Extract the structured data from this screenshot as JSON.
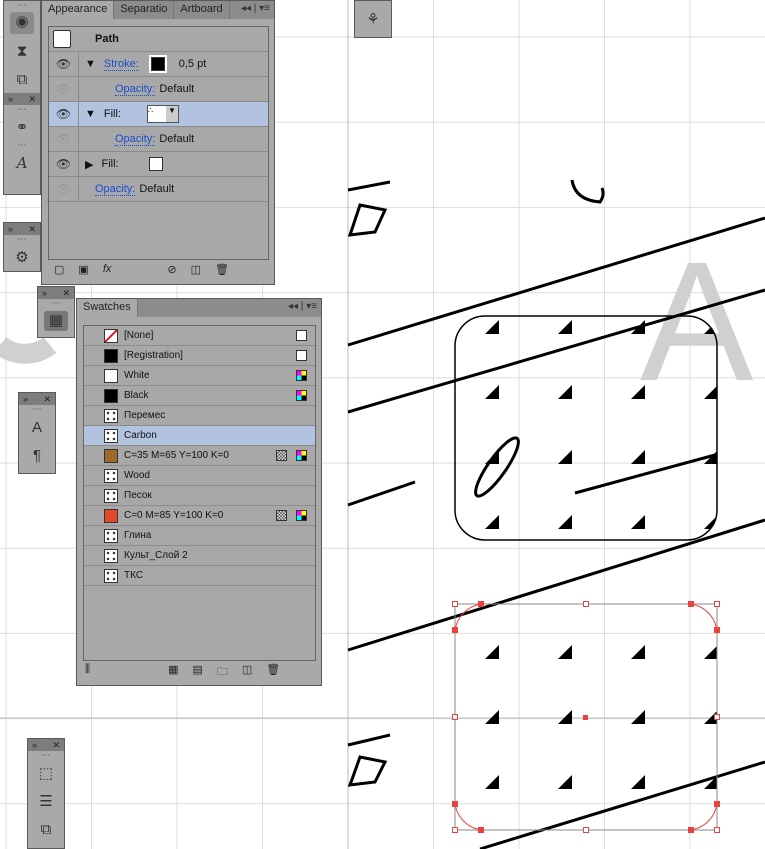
{
  "appearance": {
    "tabs": [
      "Appearance",
      "Separatio",
      "Artboard"
    ],
    "title": "Path",
    "rows": [
      {
        "label": "Stroke:",
        "value": "0,5 pt",
        "expanded": true,
        "link": true
      },
      {
        "label": "Opacity:",
        "value": "Default",
        "indent": true
      },
      {
        "label": "Fill:",
        "value": "",
        "expanded": true,
        "selected": true
      },
      {
        "label": "Opacity:",
        "value": "Default",
        "indent": true
      },
      {
        "label": "Fill:",
        "value": "",
        "expanded": false
      },
      {
        "label": "Opacity:",
        "value": "Default"
      }
    ],
    "fx_label": "fx"
  },
  "swatches": {
    "tab": "Swatches",
    "items": [
      {
        "name": "[None]",
        "color": "none"
      },
      {
        "name": "[Registration]",
        "color": "#000000"
      },
      {
        "name": "White",
        "color": "#ffffff"
      },
      {
        "name": "Black",
        "color": "#000000"
      },
      {
        "name": "Перемес",
        "color": "pattern"
      },
      {
        "name": "Carbon",
        "color": "pattern",
        "selected": true
      },
      {
        "name": "C=35 M=65 Y=100 K=0",
        "color": "#a0692c"
      },
      {
        "name": "Wood",
        "color": "pattern"
      },
      {
        "name": "Песок",
        "color": "pattern"
      },
      {
        "name": "C=0 M=85 Y=100 K=0",
        "color": "#e4472a"
      },
      {
        "name": "Глина",
        "color": "pattern"
      },
      {
        "name": "Культ_Слой 2",
        "color": "pattern"
      },
      {
        "name": "ТКС",
        "color": "pattern"
      }
    ]
  },
  "canvas": {
    "big_letter": "A",
    "selection_color": "#e8433f"
  }
}
